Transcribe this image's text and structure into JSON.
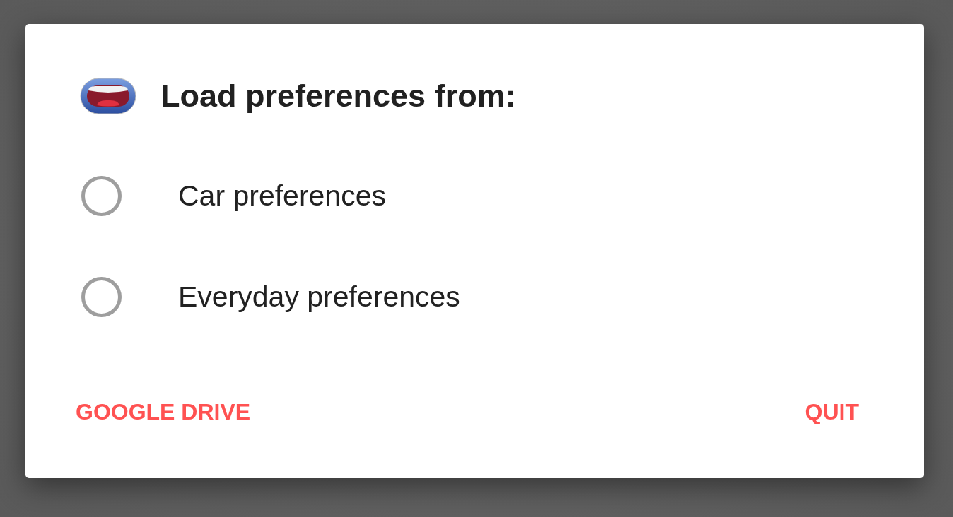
{
  "dialog": {
    "title": "Load preferences from:",
    "options": [
      {
        "label": "Car preferences",
        "selected": false
      },
      {
        "label": "Everyday preferences",
        "selected": false
      }
    ],
    "buttons": [
      {
        "label": "GOOGLE DRIVE",
        "kind": "left"
      },
      {
        "label": "QUIT",
        "kind": "right"
      }
    ]
  }
}
